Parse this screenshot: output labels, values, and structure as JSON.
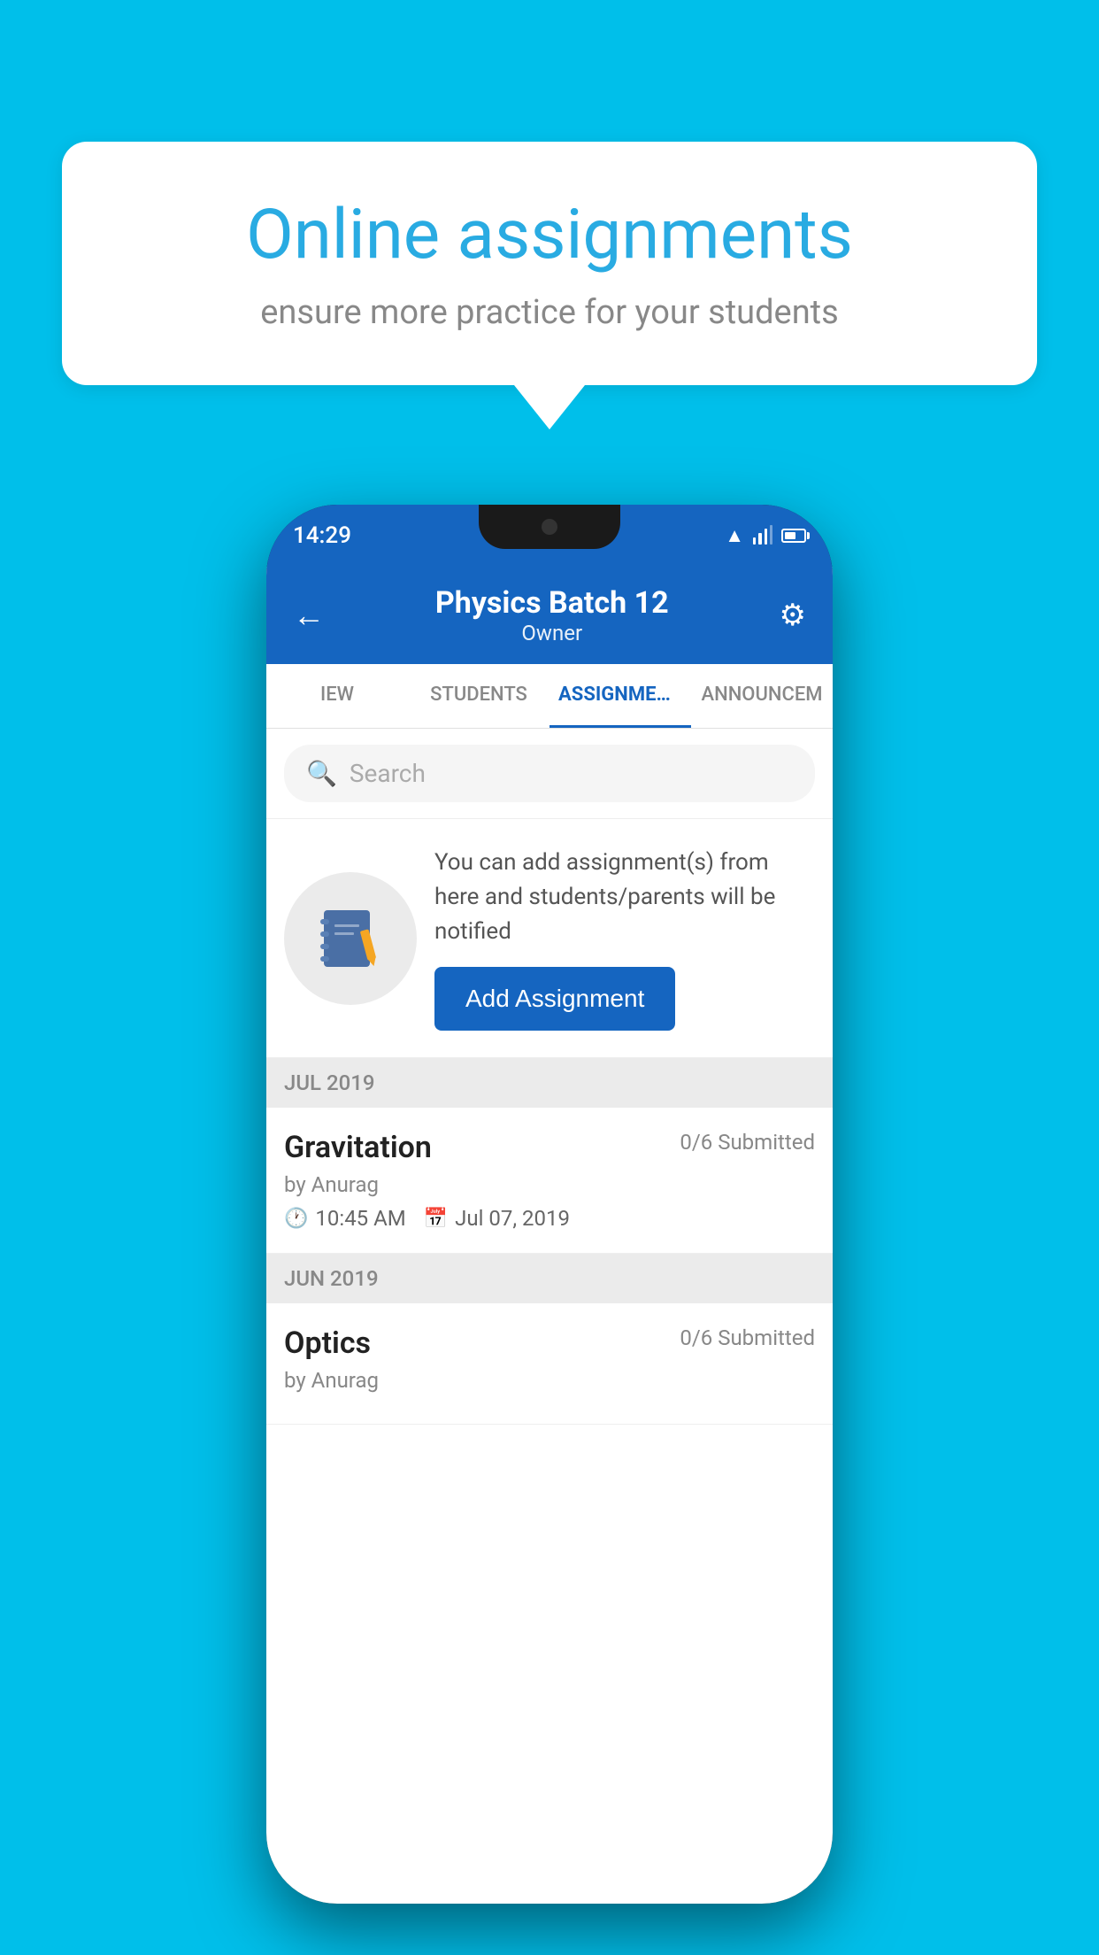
{
  "background": {
    "color": "#00BFEA"
  },
  "speech_bubble": {
    "title": "Online assignments",
    "subtitle": "ensure more practice for your students"
  },
  "phone": {
    "status_bar": {
      "time": "14:29"
    },
    "header": {
      "title": "Physics Batch 12",
      "subtitle": "Owner",
      "back_label": "←",
      "settings_label": "⚙"
    },
    "tabs": [
      {
        "label": "IEW",
        "active": false
      },
      {
        "label": "STUDENTS",
        "active": false
      },
      {
        "label": "ASSIGNMENTS",
        "active": true
      },
      {
        "label": "ANNOUNCEM",
        "active": false
      }
    ],
    "search": {
      "placeholder": "Search"
    },
    "promo": {
      "description": "You can add assignment(s) from here and students/parents will be notified",
      "add_button_label": "Add Assignment"
    },
    "assignments": {
      "sections": [
        {
          "month_label": "JUL 2019",
          "items": [
            {
              "name": "Gravitation",
              "submitted": "0/6 Submitted",
              "by": "by Anurag",
              "time": "10:45 AM",
              "date": "Jul 07, 2019"
            }
          ]
        },
        {
          "month_label": "JUN 2019",
          "items": [
            {
              "name": "Optics",
              "submitted": "0/6 Submitted",
              "by": "by Anurag",
              "time": "",
              "date": ""
            }
          ]
        }
      ]
    }
  }
}
